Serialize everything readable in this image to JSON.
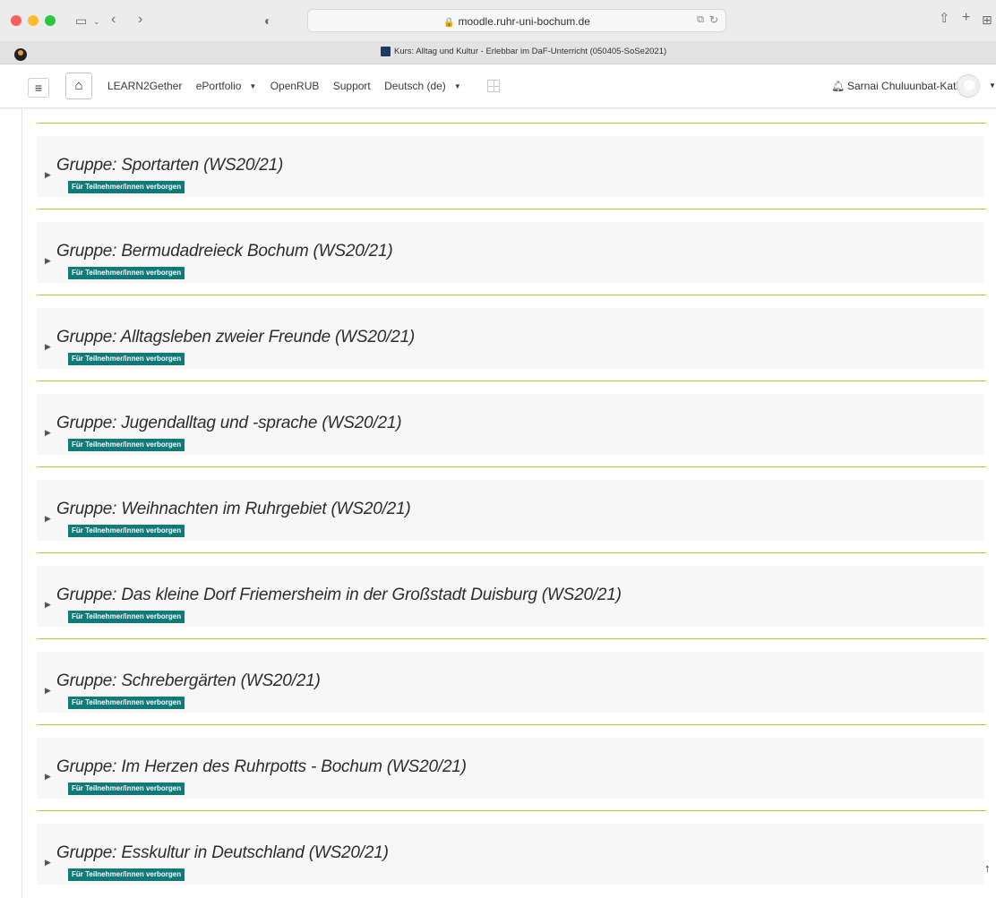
{
  "browser": {
    "url": "moodle.ruhr-uni-bochum.de",
    "tab_title": "Kurs: Alltag und Kultur - Erlebbar im DaF-Unterricht (050405-SoSe2021)"
  },
  "navbar": {
    "links": [
      {
        "label": "LEARN2Gether",
        "dropdown": false
      },
      {
        "label": "ePortfolio",
        "dropdown": true
      },
      {
        "label": "OpenRUB",
        "dropdown": false
      },
      {
        "label": "Support",
        "dropdown": false
      },
      {
        "label": "Deutsch (de)",
        "dropdown": true
      }
    ],
    "user_name": "Sarnai Chuluunbat-Kath"
  },
  "groups": [
    {
      "title": "Gruppe: Sportarten (WS20/21)",
      "badge": "Für Teilnehmer/innen verborgen"
    },
    {
      "title": "Gruppe: Bermudadreieck Bochum (WS20/21)",
      "badge": "Für Teilnehmer/innen verborgen"
    },
    {
      "title": "Gruppe: Alltagsleben zweier Freunde (WS20/21)",
      "badge": "Für Teilnehmer/innen verborgen"
    },
    {
      "title": "Gruppe: Jugendalltag und -sprache (WS20/21)",
      "badge": "Für Teilnehmer/innen verborgen"
    },
    {
      "title": "Gruppe: Weihnachten im Ruhrgebiet (WS20/21)",
      "badge": "Für Teilnehmer/innen verborgen"
    },
    {
      "title": "Gruppe: Das kleine Dorf Friemersheim in der Großstadt Duisburg (WS20/21)",
      "badge": "Für Teilnehmer/innen verborgen"
    },
    {
      "title": "Gruppe: Schrebergärten (WS20/21)",
      "badge": "Für Teilnehmer/innen verborgen"
    },
    {
      "title": "Gruppe: Im Herzen des Ruhrpotts - Bochum (WS20/21)",
      "badge": "Für Teilnehmer/innen verborgen"
    },
    {
      "title": "Gruppe: Esskultur in Deutschland (WS20/21)",
      "badge": "Für Teilnehmer/innen verborgen"
    }
  ],
  "colors": {
    "separator": "#b5c83a",
    "badge": "#0f7a7a",
    "card_bg": "#f7f7f7"
  }
}
